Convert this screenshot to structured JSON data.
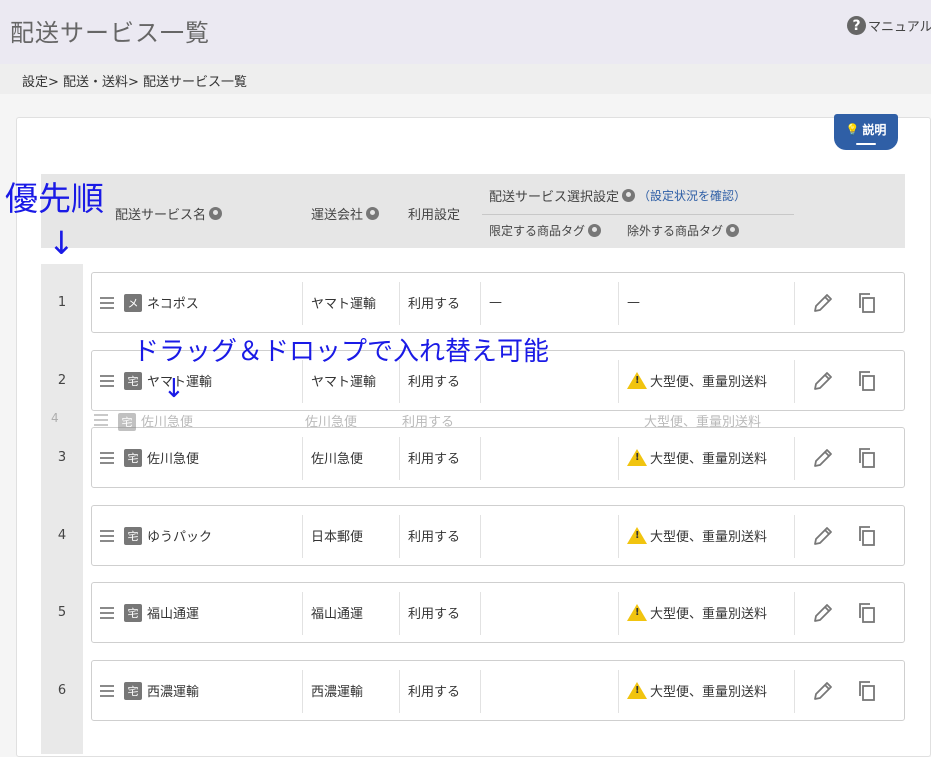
{
  "header": {
    "title": "配送サービス一覧",
    "manual_label": "マニュアル",
    "help_icon_glyph": "?"
  },
  "breadcrumb": "設定> 配送・送料> 配送サービス一覧",
  "help_button_label": "説明",
  "table_header": {
    "name": "配送サービス名",
    "carrier": "運送会社",
    "usage": "利用設定",
    "selection": "配送サービス選択設定",
    "check_link": "（設定状況を確認）",
    "limit_tags": "限定する商品タグ",
    "exclude_tags": "除外する商品タグ"
  },
  "rows": [
    {
      "priority": "1",
      "type": "メ",
      "name": "ネコポス",
      "carrier": "ヤマト運輸",
      "usage": "利用する",
      "limit": "—",
      "exclude": "—",
      "warning": false
    },
    {
      "priority": "2",
      "type": "宅",
      "name": "ヤマト運輸",
      "carrier": "ヤマト運輸",
      "usage": "利用する",
      "limit": "",
      "exclude": "大型便、重量別送料",
      "warning": true
    },
    {
      "priority": "3",
      "type": "宅",
      "name": "佐川急便",
      "carrier": "佐川急便",
      "usage": "利用する",
      "limit": "",
      "exclude": "大型便、重量別送料",
      "warning": true
    },
    {
      "priority": "4",
      "type": "宅",
      "name": "ゆうパック",
      "carrier": "日本郵便",
      "usage": "利用する",
      "limit": "",
      "exclude": "大型便、重量別送料",
      "warning": true
    },
    {
      "priority": "5",
      "type": "宅",
      "name": "福山通運",
      "carrier": "福山通運",
      "usage": "利用する",
      "limit": "",
      "exclude": "大型便、重量別送料",
      "warning": true
    },
    {
      "priority": "6",
      "type": "宅",
      "name": "西濃運輸",
      "carrier": "西濃運輸",
      "usage": "利用する",
      "limit": "",
      "exclude": "大型便、重量別送料",
      "warning": true
    }
  ],
  "dragging_ghost": {
    "priority": "4",
    "type": "宅",
    "name": "佐川急便",
    "carrier": "佐川急便",
    "usage": "利用する",
    "exclude": "大型便、重量別送料"
  },
  "annotations": {
    "priority_label": "優先順",
    "arrow": "↓",
    "drag_hint": "ドラッグ＆ドロップで入れ替え可能",
    "drag_arrow": "↓"
  },
  "colors": {
    "accent": "#2f5fa6",
    "warning": "#f1c40f",
    "annotation": "#1a1ae6"
  },
  "icons": {
    "edit": "pencil-icon",
    "copy": "copy-icon",
    "drag": "drag-handle-icon",
    "help": "question-icon",
    "info": "info-icon",
    "warning": "warning-icon",
    "bulb": "bulb-icon"
  }
}
